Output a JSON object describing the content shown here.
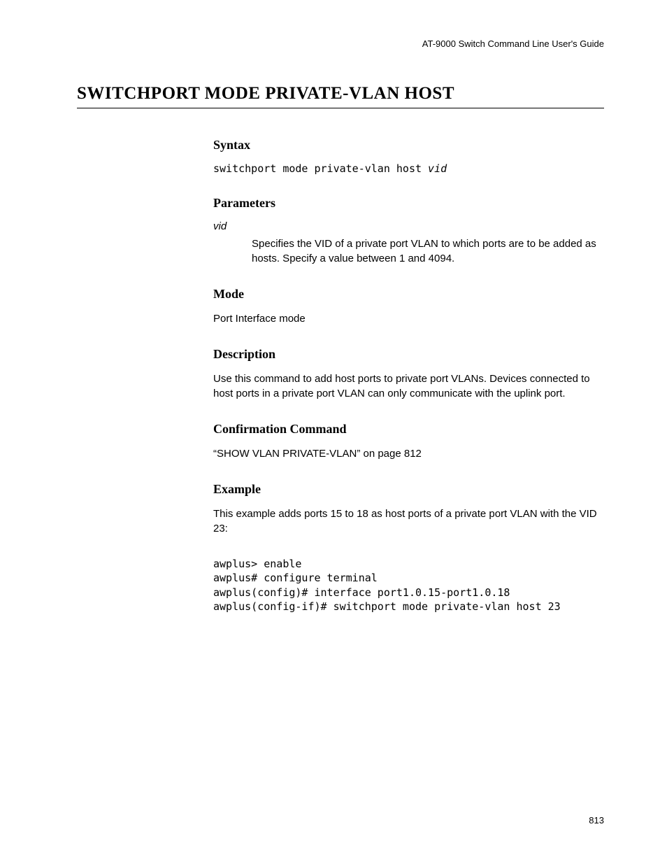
{
  "header": {
    "running": "AT-9000 Switch Command Line User's Guide"
  },
  "title": "SWITCHPORT MODE PRIVATE-VLAN HOST",
  "sections": {
    "syntax": {
      "heading": "Syntax",
      "command_prefix": "switchport mode private-vlan host ",
      "command_arg": "vid"
    },
    "parameters": {
      "heading": "Parameters",
      "param_name": "vid",
      "param_desc": "Specifies the VID of a private port VLAN to which ports are to be added as hosts. Specify a value between 1 and 4094."
    },
    "mode": {
      "heading": "Mode",
      "text": "Port Interface mode"
    },
    "description": {
      "heading": "Description",
      "text": "Use this command to add host ports to private port VLANs. Devices connected to host ports in a private port VLAN can only communicate with the uplink port."
    },
    "confirmation": {
      "heading": "Confirmation Command",
      "text": "“SHOW VLAN PRIVATE-VLAN” on page 812"
    },
    "example": {
      "heading": "Example",
      "intro": "This example adds ports 15 to 18 as host ports of a private port VLAN with the VID 23:",
      "code": "awplus> enable\nawplus# configure terminal\nawplus(config)# interface port1.0.15-port1.0.18\nawplus(config-if)# switchport mode private-vlan host 23"
    }
  },
  "page_number": "813"
}
